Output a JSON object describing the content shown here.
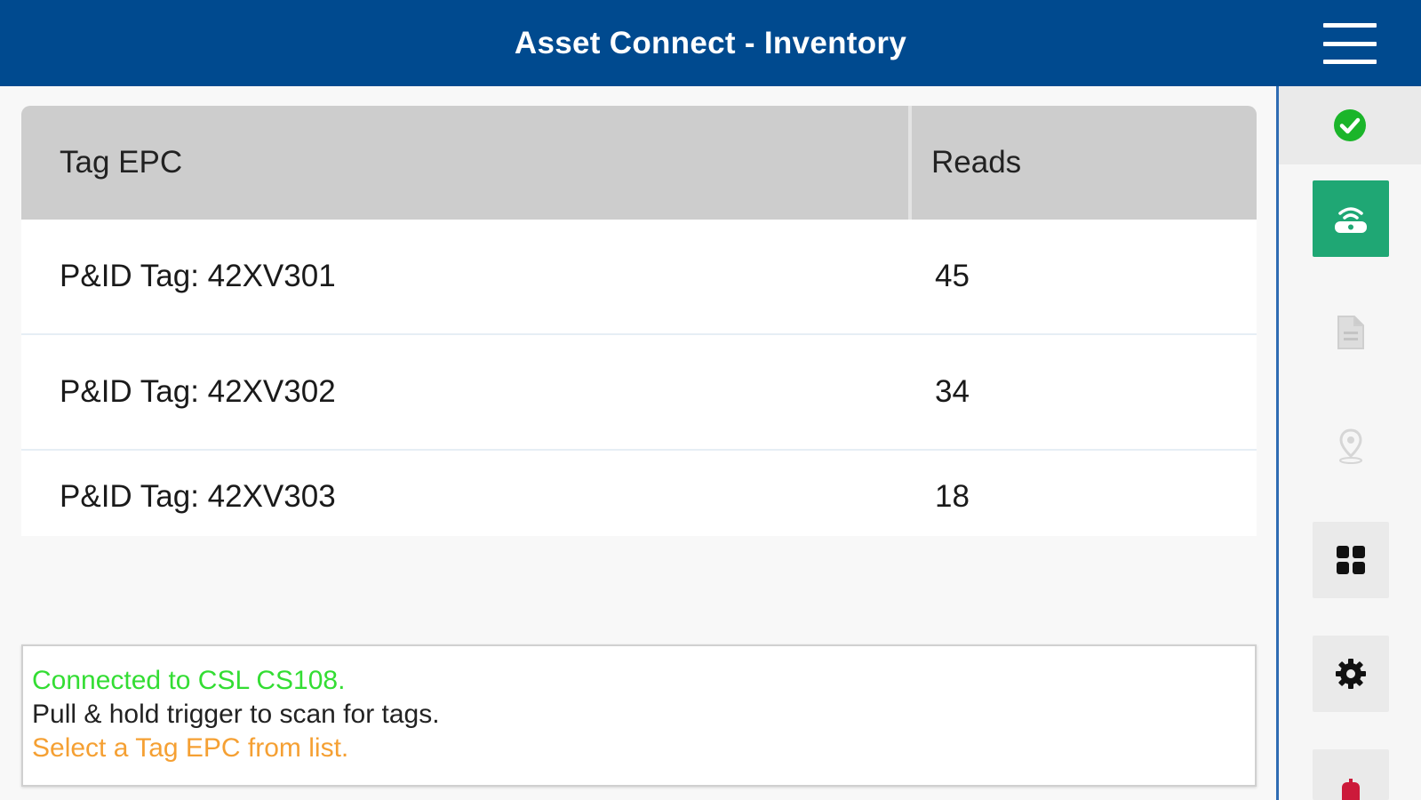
{
  "header": {
    "title": "Asset Connect - Inventory",
    "menu_icon": "hamburger-menu-icon"
  },
  "table": {
    "columns": [
      "Tag EPC",
      "Reads"
    ],
    "rows": [
      {
        "epc": "P&ID Tag: 42XV301",
        "reads": "45"
      },
      {
        "epc": "P&ID Tag: 42XV302",
        "reads": "34"
      },
      {
        "epc": "P&ID Tag: 42XV303",
        "reads": "18"
      }
    ]
  },
  "status": {
    "connected": "Connected to CSL CS108.",
    "instruction": "Pull & hold trigger to scan for tags.",
    "prompt": "Select a Tag EPC from list."
  },
  "sidebar": {
    "items": [
      {
        "icon": "check-circle-icon",
        "state": "connected"
      },
      {
        "icon": "rfid-reader-icon",
        "state": "active"
      },
      {
        "icon": "document-icon",
        "state": "disabled"
      },
      {
        "icon": "location-pin-icon",
        "state": "disabled"
      },
      {
        "icon": "grid-icon",
        "state": "enabled"
      },
      {
        "icon": "gear-icon",
        "state": "enabled"
      },
      {
        "icon": "exit-icon",
        "state": "enabled"
      }
    ]
  },
  "colors": {
    "header_bg": "#004a8f",
    "active_btn": "#1fa774",
    "status_connected": "#33dd33",
    "status_prompt": "#f5a033",
    "status_ok": "#1bb52a"
  }
}
